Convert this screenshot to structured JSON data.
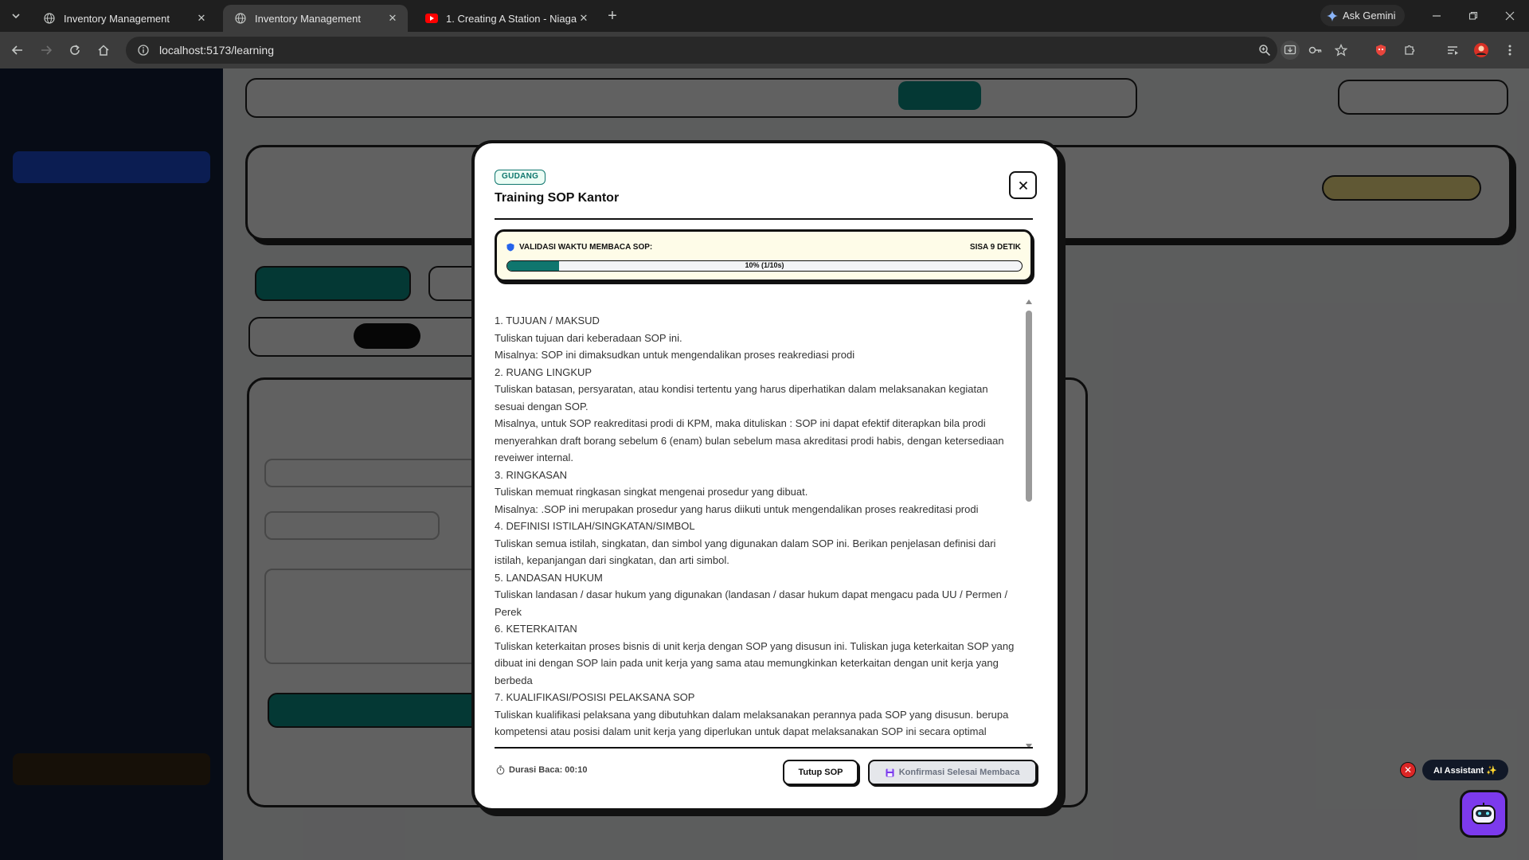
{
  "browser": {
    "tabs": [
      {
        "title": "Inventory Management",
        "active": false
      },
      {
        "title": "Inventory Management",
        "active": true
      },
      {
        "title": "1. Creating A Station - Niagara",
        "active": false
      }
    ],
    "gemini_label": "Ask Gemini",
    "url": "localhost:5173/learning"
  },
  "modal": {
    "badge": "GUDANG",
    "title": "Training SOP Kantor",
    "timer": {
      "label": "VALIDASI WAKTU MEMBACA SOP:",
      "remaining": "SISA 9 DETIK",
      "progress_percent": 10,
      "progress_text": "10% (1/10s)"
    },
    "content_lines": [
      "1. TUJUAN / MAKSUD",
      "Tuliskan tujuan dari keberadaan SOP ini.",
      "Misalnya: SOP ini dimaksudkan untuk mengendalikan proses reakrediasi prodi",
      "2. RUANG LINGKUP",
      "Tuliskan batasan, persyaratan, atau kondisi tertentu yang harus diperhatikan dalam melaksanakan kegiatan sesuai dengan SOP.",
      "Misalnya, untuk SOP reakreditasi prodi di KPM, maka dituliskan : SOP ini dapat efektif diterapkan bila prodi menyerahkan draft borang sebelum 6 (enam) bulan sebelum masa akreditasi prodi habis, dengan ketersediaan reveiwer internal.",
      "3. RINGKASAN",
      "Tuliskan memuat ringkasan singkat mengenai prosedur yang dibuat.",
      "Misalnya: .SOP ini merupakan prosedur yang harus diikuti untuk mengendalikan proses reakreditasi prodi",
      "4. DEFINISI ISTILAH/SINGKATAN/SIMBOL",
      "Tuliskan semua istilah, singkatan, dan simbol yang digunakan dalam SOP ini. Berikan penjelasan definisi dari istilah, kepanjangan dari singkatan, dan arti simbol.",
      "5. LANDASAN HUKUM",
      "Tuliskan landasan / dasar hukum yang digunakan (landasan / dasar hukum dapat mengacu pada UU / Permen / Perek",
      "6. KETERKAITAN",
      "Tuliskan keterkaitan proses bisnis di unit kerja dengan SOP yang disusun ini. Tuliskan juga keterkaitan SOP yang dibuat ini dengan SOP lain pada unit kerja yang sama atau memungkinkan keterkaitan dengan unit kerja yang berbeda",
      "7. KUALIFIKASI/POSISI PELAKSANA SOP",
      "Tuliskan kualifikasi pelaksana yang dibutuhkan dalam melaksanakan perannya pada SOP yang disusun. berupa kompetensi atau posisi dalam unit kerja yang diperlukan untuk dapat melaksanakan SOP ini secara optimal"
    ],
    "duration_label": "Durasi Baca: 00:10",
    "close_button": "Tutup SOP",
    "confirm_button": "Konfirmasi Selesai Membaca"
  },
  "assistant": {
    "label": "AI Assistant ✨"
  },
  "colors": {
    "accent": "#0f766e",
    "badge_bg": "#ecfdf5",
    "timer_bg": "#fefce8",
    "assistant_bot": "#7c3aed",
    "close_red": "#dc2626"
  },
  "icons": {
    "timer": "shield-icon",
    "duration": "stopwatch-icon",
    "confirm": "floppy-icon",
    "bot": "robot-icon"
  }
}
